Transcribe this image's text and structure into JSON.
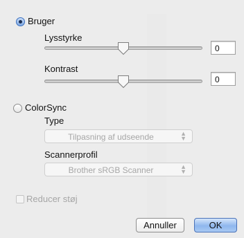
{
  "modes": {
    "user_label": "Bruger",
    "colorsync_label": "ColorSync"
  },
  "brightness": {
    "label": "Lysstyrke",
    "value": "0",
    "level": 0.5
  },
  "contrast": {
    "label": "Kontrast",
    "value": "0",
    "level": 0.5
  },
  "colorsync": {
    "type_label": "Type",
    "type_value": "Tilpasning af udseende",
    "profile_label": "Scannerprofil",
    "profile_value": "Brother sRGB Scanner"
  },
  "noise": {
    "label": "Reducer støj",
    "checked": false
  },
  "buttons": {
    "cancel": "Annuller",
    "ok": "OK"
  },
  "colors": {
    "accent": "#7fa9e3",
    "disabled_text": "#a6a6a6"
  }
}
